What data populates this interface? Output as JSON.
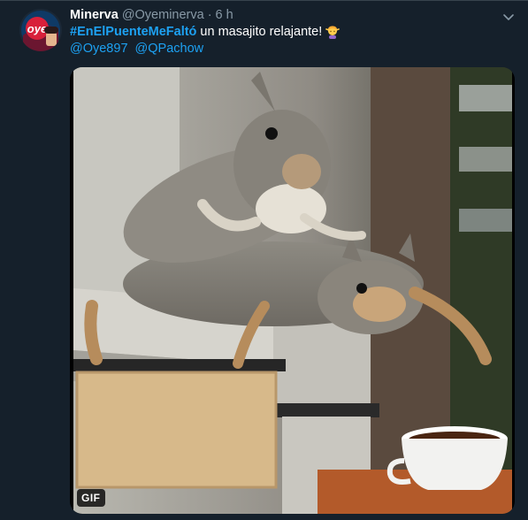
{
  "tweet": {
    "display_name": "Minerva",
    "handle": "@Oyeminerva",
    "separator": "·",
    "time": "6 h",
    "hashtag": "#EnElPuenteMeFaltó",
    "text": "un masajito relajante!",
    "emoji_icon": "person-getting-massage-emoji",
    "mentions": [
      "@Oye897",
      "@QPachow"
    ],
    "avatar_text": "oye",
    "media": {
      "badge": "GIF"
    }
  },
  "colors": {
    "background": "#15202b",
    "link": "#1da1f2",
    "secondary": "#8899a6"
  }
}
